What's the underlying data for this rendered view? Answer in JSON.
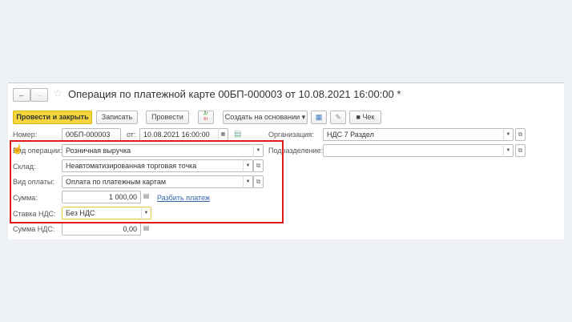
{
  "title": "Операция по платежной карте 00БП-000003 от 10.08.2021 16:00:00 *",
  "toolbar": {
    "post_close": "Провести и закрыть",
    "save": "Записать",
    "post": "Провести",
    "dtkt": "Дт Кт",
    "create_based": "Создать на основании",
    "check": "Чек"
  },
  "fields": {
    "number_label": "Номер:",
    "number": "00БП-000003",
    "from_label": "от:",
    "date": "10.08.2021 16:00:00",
    "org_label": "Организация:",
    "org": "НДС 7 Раздел",
    "op_label": "Вид операции:",
    "op": "Розничная выручка",
    "div_label": "Подразделение:",
    "div": "",
    "warehouse_label": "Склад:",
    "warehouse": "Неавтоматизированная торговая точка",
    "paytype_label": "Вид оплаты:",
    "paytype": "Оплата по платежным картам",
    "sum_label": "Сумма:",
    "sum": "1 000,00",
    "split_link": "Разбить платеж",
    "vat_rate_label": "Ставка НДС:",
    "vat_rate": "Без НДС",
    "vat_sum_label": "Сумма НДС:",
    "vat_sum": "0,00"
  },
  "colors": {
    "accent": "#f5d63d",
    "highlight": "#e01b1b"
  }
}
